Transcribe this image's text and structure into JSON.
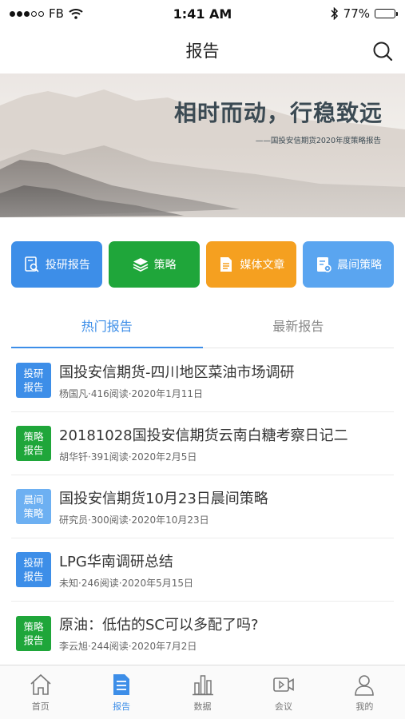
{
  "status_bar": {
    "carrier": "FB",
    "time": "1:41 AM",
    "battery": "77%",
    "battery_level": 0.77
  },
  "nav": {
    "title": "报告"
  },
  "banner": {
    "title": "相时而动，行稳致远",
    "subtitle": "——国投安信期货2020年度策略报告"
  },
  "categories": [
    {
      "label": "投研报告",
      "icon": "search-document-icon",
      "color": "#3d8ee8"
    },
    {
      "label": "策略",
      "icon": "layers-icon",
      "color": "#1fa63a"
    },
    {
      "label": "媒体文章",
      "icon": "document-icon",
      "color": "#f5a020"
    },
    {
      "label": "晨间策略",
      "icon": "list-document-icon",
      "color": "#5aa5f0"
    }
  ],
  "tabs": [
    {
      "label": "热门报告",
      "active": true
    },
    {
      "label": "最新报告",
      "active": false
    }
  ],
  "reports": [
    {
      "badge_line1": "投研",
      "badge_line2": "报告",
      "badge_color": "blue",
      "title": "国投安信期货-四川地区菜油市场调研",
      "meta": "杨国凡·416阅读·2020年1月11日"
    },
    {
      "badge_line1": "策略",
      "badge_line2": "报告",
      "badge_color": "green",
      "title": "20181028国投安信期货云南白糖考察日记二",
      "meta": "胡华钎·391阅读·2020年2月5日"
    },
    {
      "badge_line1": "晨间",
      "badge_line2": "策略",
      "badge_color": "lblue",
      "title": "国投安信期货10月23日晨间策略",
      "meta": "研究员·300阅读·2020年10月23日"
    },
    {
      "badge_line1": "投研",
      "badge_line2": "报告",
      "badge_color": "blue",
      "title": "LPG华南调研总结",
      "meta": "未知·246阅读·2020年5月15日"
    },
    {
      "badge_line1": "策略",
      "badge_line2": "报告",
      "badge_color": "green",
      "title": "原油：低估的SC可以多配了吗?",
      "meta": "李云旭·244阅读·2020年7月2日"
    }
  ],
  "tabbar": [
    {
      "label": "首页",
      "icon": "home-icon",
      "active": false
    },
    {
      "label": "报告",
      "icon": "report-icon",
      "active": true
    },
    {
      "label": "数据",
      "icon": "bar-chart-icon",
      "active": false
    },
    {
      "label": "会议",
      "icon": "video-icon",
      "active": false
    },
    {
      "label": "我的",
      "icon": "user-icon",
      "active": false
    }
  ],
  "colors": {
    "accent": "#3d8ee8",
    "green": "#1fa63a",
    "orange": "#f5a020",
    "light_blue": "#5aa5f0"
  }
}
